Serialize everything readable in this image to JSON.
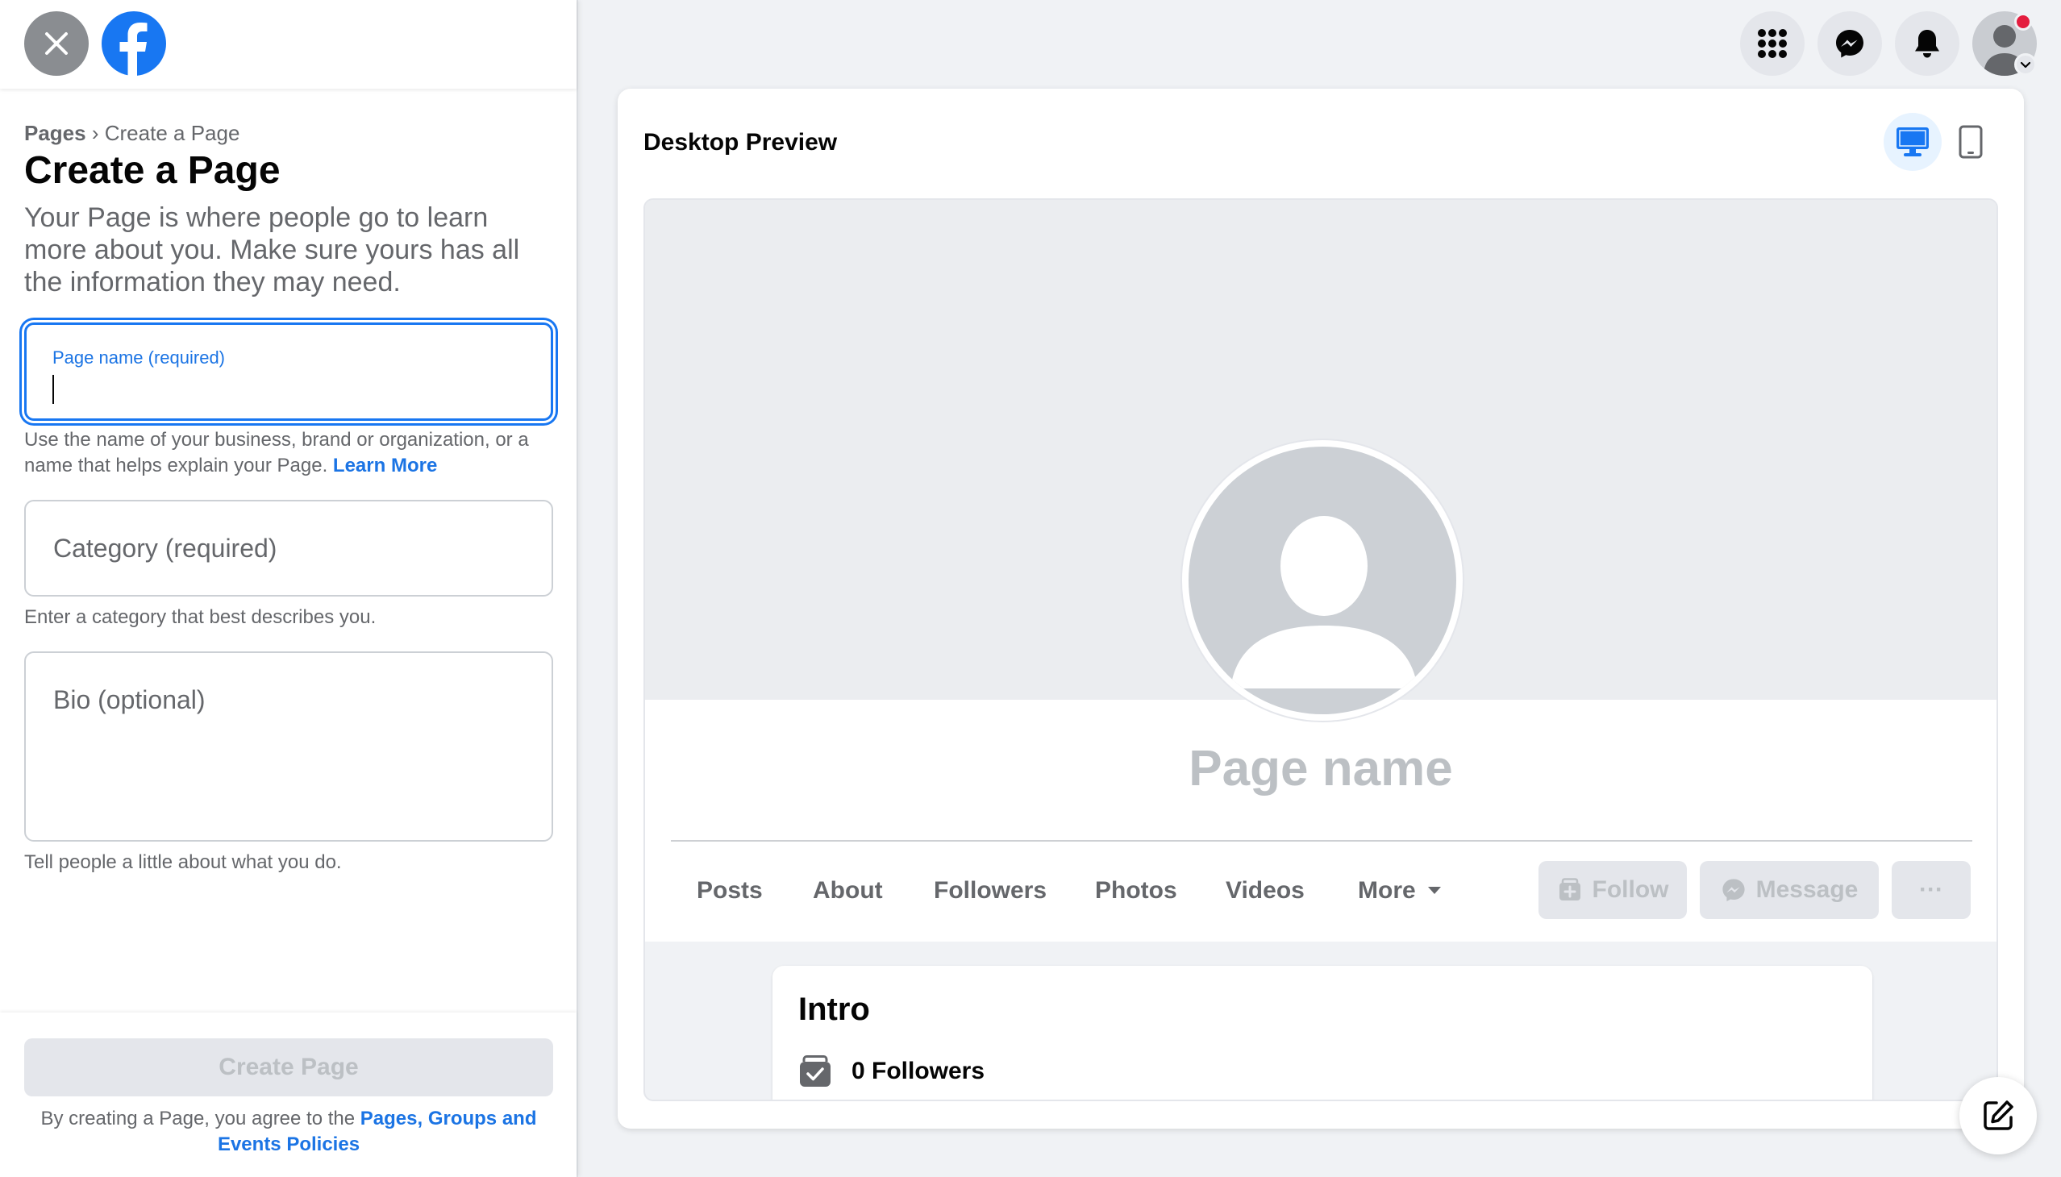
{
  "left_panel": {
    "breadcrumb": {
      "parent": "Pages",
      "separator": "›",
      "current": "Create a Page"
    },
    "title": "Create a Page",
    "description": "Your Page is where people go to learn more about you. Make sure yours has all the information they may need.",
    "page_name_field": {
      "label": "Page name (required)",
      "value": ""
    },
    "page_name_hint": "Use the name of your business, brand or organization, or a name that helps explain your Page.",
    "learn_more": "Learn More",
    "category_field": {
      "placeholder": "Category (required)"
    },
    "category_hint": "Enter a category that best describes you.",
    "bio_field": {
      "placeholder": "Bio (optional)"
    },
    "bio_hint": "Tell people a little about what you do.",
    "create_button": "Create Page",
    "terms_prefix": "By creating a Page, you agree to the",
    "terms_link": "Pages, Groups and Events Policies"
  },
  "top_nav": {
    "icons": [
      "menu-grid-icon",
      "messenger-icon",
      "bell-icon",
      "account-avatar"
    ]
  },
  "preview": {
    "title": "Desktop Preview",
    "page_name": "Page name",
    "tabs": [
      "Posts",
      "About",
      "Followers",
      "Photos",
      "Videos",
      "More"
    ],
    "follow_button": "Follow",
    "message_button": "Message",
    "more_button": "···",
    "intro_title": "Intro",
    "followers": "0 Followers"
  },
  "colors": {
    "accent": "#1877f2",
    "link": "#1b74e4",
    "notification": "#e41e3f",
    "disabled_text": "#bcc0c4"
  }
}
